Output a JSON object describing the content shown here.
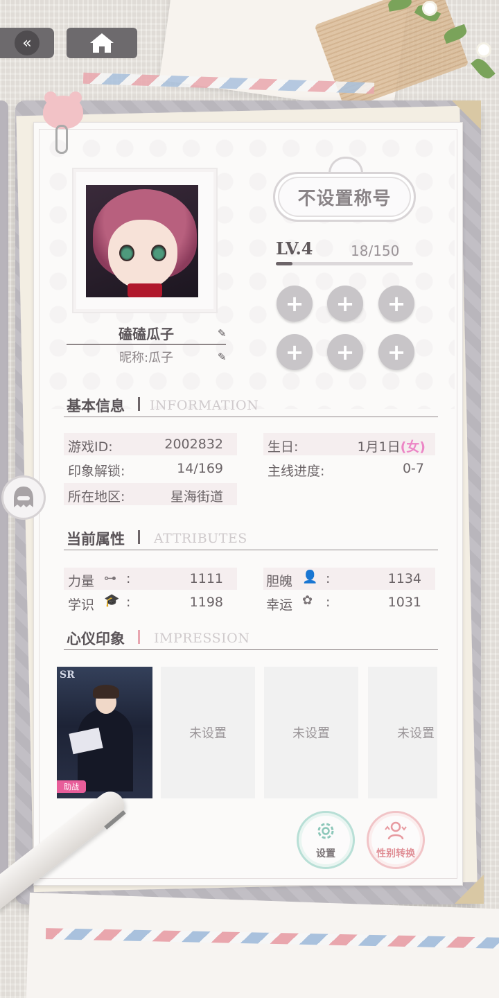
{
  "nav": {
    "back_icon": "«",
    "home_icon": "home-icon"
  },
  "profile": {
    "name": "磕磕瓜子",
    "nickname": "昵称:瓜子",
    "title": "不设置称号",
    "level": "LV.4",
    "exp": "18/150",
    "exp_progress": 0.12,
    "badge_slots": [
      "+",
      "+",
      "+",
      "+",
      "+",
      "+"
    ]
  },
  "basic_info": {
    "title": "基本信息",
    "title_en": "INFORMATION",
    "game_id_label": "游戏ID:",
    "game_id": "2002832",
    "birthday_label": "生日:",
    "birthday": "1月1日",
    "gender": "(女)",
    "impression_label": "印象解锁:",
    "impression_value": "14/169",
    "progress_label": "主线进度:",
    "progress_value": "0-7",
    "region_label": "所在地区:",
    "region_value": "星海街道"
  },
  "attributes": {
    "title": "当前属性",
    "title_en": "ATTRIBUTES",
    "items": [
      {
        "label": "力量",
        "icon": "dumbbell-icon",
        "value": "1111"
      },
      {
        "label": "胆魄",
        "icon": "person-icon",
        "value": "1134"
      },
      {
        "label": "学识",
        "icon": "graduation-cap-icon",
        "value": "1198"
      },
      {
        "label": "幸运",
        "icon": "clover-icon",
        "value": "1031"
      }
    ],
    "colon": ":"
  },
  "impression": {
    "title": "心仪印象",
    "title_en": "IMPRESSION",
    "card_badge": "SR",
    "card_tag": "助战",
    "empty_label": "未设置",
    "slots": [
      "未设置",
      "未设置",
      "未设置"
    ]
  },
  "actions": {
    "settings_label": "设置",
    "gender_switch_label": "性别转换"
  },
  "colors": {
    "accent_pink": "#ec86c6",
    "settings_green": "#8cc7b9",
    "gender_red": "#e79aa0",
    "panel_gray": "#6d6a6d"
  }
}
